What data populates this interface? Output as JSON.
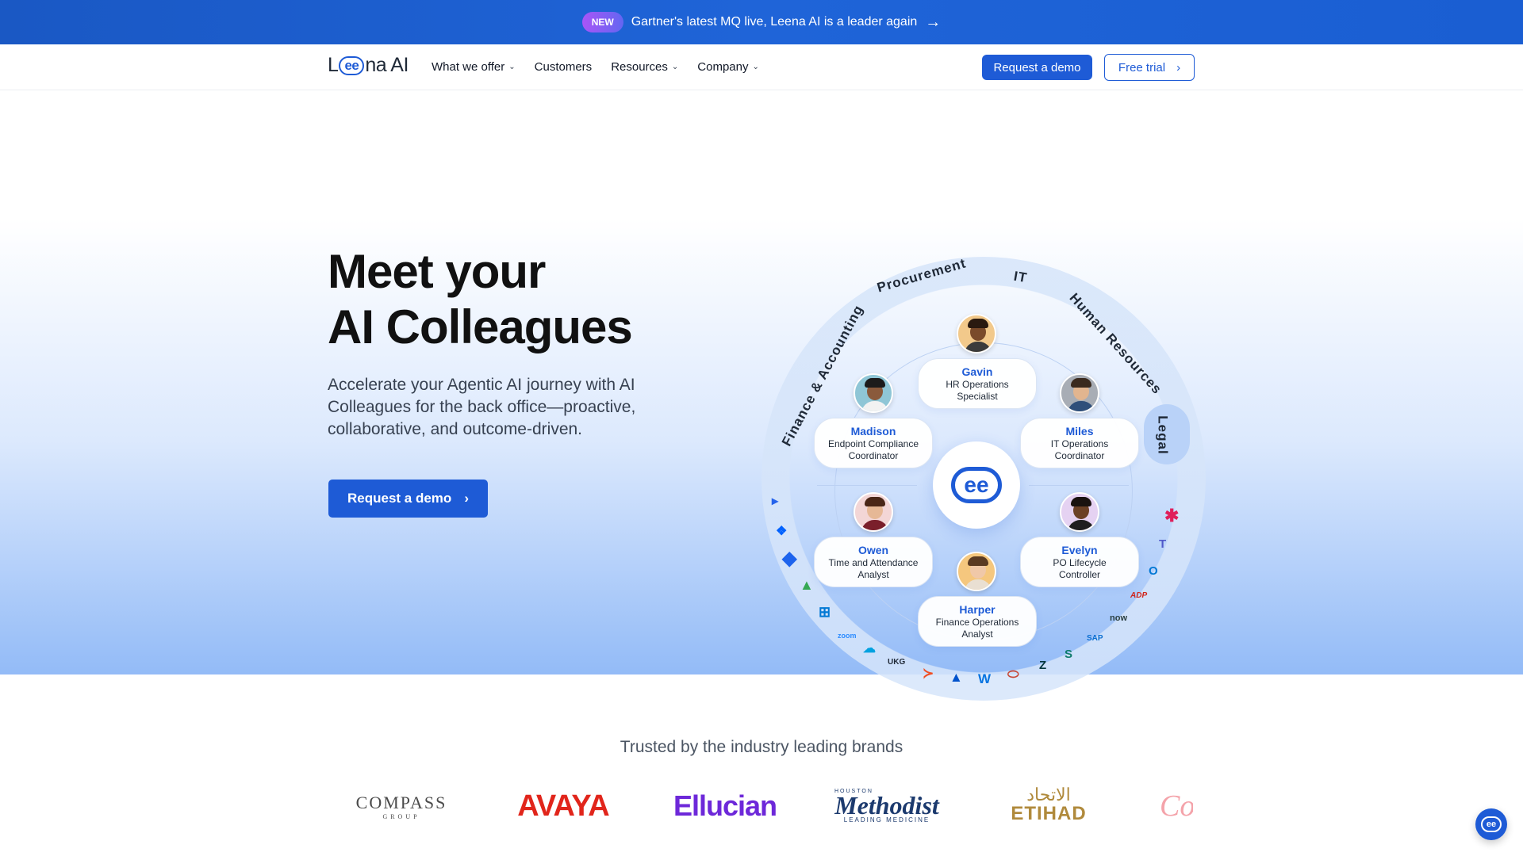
{
  "announcement": {
    "badge": "NEW",
    "text": "Gartner's latest MQ live, Leena AI is a leader again",
    "arrow": "→"
  },
  "nav": {
    "logo": {
      "pre": "L",
      "mark": "ee",
      "post": "na AI"
    },
    "menu": [
      {
        "label": "What we offer",
        "has_dropdown": true
      },
      {
        "label": "Customers",
        "has_dropdown": false
      },
      {
        "label": "Resources",
        "has_dropdown": true
      },
      {
        "label": "Company",
        "has_dropdown": true
      }
    ],
    "chevron": "⌄",
    "request_demo": "Request a demo",
    "free_trial": "Free trial",
    "free_trial_arrow": "›"
  },
  "hero": {
    "title_line1": "Meet your",
    "title_line2": "AI Colleagues",
    "subtitle": "Accelerate your Agentic AI journey with AI Colleagues for the back office—proactive, collaborative, and outcome-driven.",
    "cta": "Request a demo",
    "cta_arrow": "›"
  },
  "wheel": {
    "center_mark": "ee",
    "departments": [
      "Finance & Accounting",
      "Procurement",
      "IT",
      "Human Resources",
      "Legal"
    ],
    "colleagues": [
      {
        "name": "Gavin",
        "role_line1": "HR Operations",
        "role_line2": "Specialist"
      },
      {
        "name": "Madison",
        "role_line1": "Endpoint Compliance",
        "role_line2": "Coordinator"
      },
      {
        "name": "Miles",
        "role_line1": "IT Operations",
        "role_line2": "Coordinator"
      },
      {
        "name": "Owen",
        "role_line1": "Time and Attendance",
        "role_line2": "Analyst"
      },
      {
        "name": "Evelyn",
        "role_line1": "PO Lifecycle",
        "role_line2": "Controller"
      },
      {
        "name": "Harper",
        "role_line1": "Finance Operations",
        "role_line2": "Analyst"
      }
    ],
    "integrations": [
      {
        "icon": "dynamics-icon",
        "text": "▸",
        "color": "#2563eb"
      },
      {
        "icon": "dropbox-icon",
        "text": "❖",
        "color": "#0061fe"
      },
      {
        "icon": "jira-icon",
        "text": "◆",
        "color": "#1d63ed"
      },
      {
        "icon": "google-drive-icon",
        "text": "▲",
        "color": "#34a853"
      },
      {
        "icon": "windows-icon",
        "text": "⊞",
        "color": "#0078d4"
      },
      {
        "icon": "zoom-icon",
        "text": "zoom",
        "color": "#2d8cff"
      },
      {
        "icon": "salesforce-icon",
        "text": "☁",
        "color": "#00a1e0"
      },
      {
        "icon": "ukg-icon",
        "text": "UKG",
        "color": "#1f2937"
      },
      {
        "icon": "bamboo-icon",
        "text": "≻",
        "color": "#f04e23"
      },
      {
        "icon": "atlassian-icon",
        "text": "▲",
        "color": "#0052cc"
      },
      {
        "icon": "workday-icon",
        "text": "W",
        "color": "#0875e1"
      },
      {
        "icon": "oracle-icon",
        "text": "⬭",
        "color": "#c74634"
      },
      {
        "icon": "zendesk-icon",
        "text": "Z",
        "color": "#03363d"
      },
      {
        "icon": "sharepoint-icon",
        "text": "S",
        "color": "#0f7b6c"
      },
      {
        "icon": "sap-icon",
        "text": "SAP",
        "color": "#0a6ed1"
      },
      {
        "icon": "servicenow-icon",
        "text": "now",
        "color": "#293e40"
      },
      {
        "icon": "adp-icon",
        "text": "ADP",
        "color": "#d0271d"
      },
      {
        "icon": "outlook-icon",
        "text": "O",
        "color": "#0078d4"
      },
      {
        "icon": "teams-icon",
        "text": "T",
        "color": "#5059c9"
      },
      {
        "icon": "slack-icon",
        "text": "✱",
        "color": "#e01e5a"
      }
    ]
  },
  "brands": {
    "title": "Trusted by the industry leading brands",
    "compass": {
      "name": "COMPASS",
      "sub": "GROUP"
    },
    "avaya": "AVAYA",
    "ellucian": "Ellucian",
    "methodist": {
      "top": "HOUSTON",
      "name": "Methodist",
      "sub": "LEADING MEDICINE"
    },
    "etihad": {
      "arabic": "الاتحاد",
      "name": "ETIHAD"
    },
    "coca_cola": "Co"
  },
  "chat": {
    "mark": "ee"
  },
  "colors": {
    "primary": "#1e5bd6",
    "announcement": "#1f64d8"
  }
}
